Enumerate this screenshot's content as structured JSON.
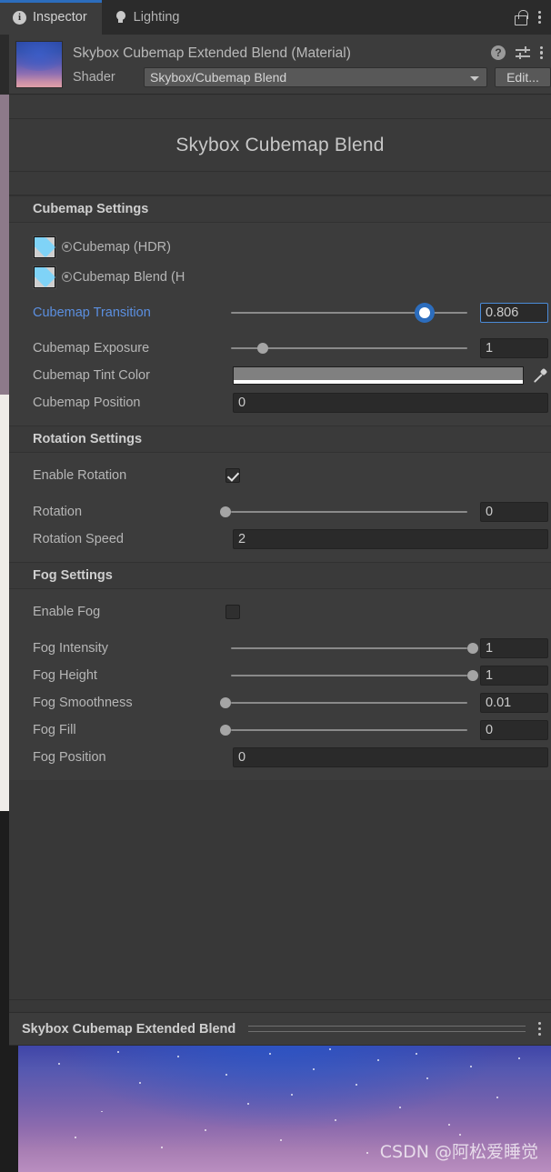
{
  "window": {
    "tabs": [
      {
        "label": "Inspector",
        "icon": "info-icon",
        "active": true
      },
      {
        "label": "Lighting",
        "icon": "light-bulb-icon",
        "active": false
      }
    ],
    "lock_icon": "lock-open-icon",
    "menu_icon": "kebab-menu-icon"
  },
  "material_header": {
    "title": "Skybox Cubemap Extended Blend (Material)",
    "help_icon": "help-icon",
    "preset_icon": "preset-icon",
    "menu_icon": "kebab-menu-icon",
    "shader_label": "Shader",
    "shader_value": "Skybox/Cubemap Blend",
    "edit_button": "Edit..."
  },
  "shader_title": "Skybox Cubemap Blend",
  "sections": [
    {
      "header": "Cubemap Settings",
      "rows": [
        {
          "type": "object",
          "label": "Cubemap (HDR)",
          "icon": "cubemap-texture-icon"
        },
        {
          "type": "object",
          "label": "Cubemap Blend (H",
          "icon": "cubemap-texture-icon"
        },
        {
          "type": "slider",
          "label": "Cubemap Transition",
          "value": "0.806",
          "percent": 80.6,
          "accent": true,
          "selected": true
        },
        {
          "type": "slider",
          "label": "Cubemap Exposure",
          "value": "1",
          "percent": 15,
          "accent": false,
          "selected": false
        },
        {
          "type": "color",
          "label": "Cubemap Tint Color",
          "color": "#808080",
          "alpha": "#ffffff",
          "eyedropper_icon": "eyedropper-icon"
        },
        {
          "type": "text",
          "label": "Cubemap Position",
          "value": "0"
        }
      ]
    },
    {
      "header": "Rotation Settings",
      "rows": [
        {
          "type": "checkbox",
          "label": "Enable Rotation",
          "checked": true
        },
        {
          "type": "slider",
          "label": "Rotation",
          "value": "0",
          "percent": 0,
          "accent": false,
          "selected": false
        },
        {
          "type": "text",
          "label": "Rotation Speed",
          "value": "2"
        }
      ]
    },
    {
      "header": "Fog Settings",
      "rows": [
        {
          "type": "checkbox",
          "label": "Enable Fog",
          "checked": false
        },
        {
          "type": "slider",
          "label": "Fog Intensity",
          "value": "1",
          "percent": 100,
          "accent": false,
          "selected": false
        },
        {
          "type": "slider",
          "label": "Fog Height",
          "value": "1",
          "percent": 100,
          "accent": false,
          "selected": false
        },
        {
          "type": "slider",
          "label": "Fog Smoothness",
          "value": "0.01",
          "percent": 0,
          "accent": false,
          "selected": false
        },
        {
          "type": "slider",
          "label": "Fog Fill",
          "value": "0",
          "percent": 0,
          "accent": false,
          "selected": false
        },
        {
          "type": "text",
          "label": "Fog Position",
          "value": "0"
        }
      ]
    }
  ],
  "preview": {
    "title": "Skybox Cubemap Extended Blend",
    "menu_icon": "kebab-menu-icon",
    "watermark": "CSDN @阿松爱睡觉"
  },
  "colors": {
    "accent_blue": "#2c6dbd",
    "label_blue": "#5b8fe0",
    "panel_bg": "#383838",
    "section_bg": "#3c3c3c",
    "field_bg": "#2a2a2a"
  }
}
